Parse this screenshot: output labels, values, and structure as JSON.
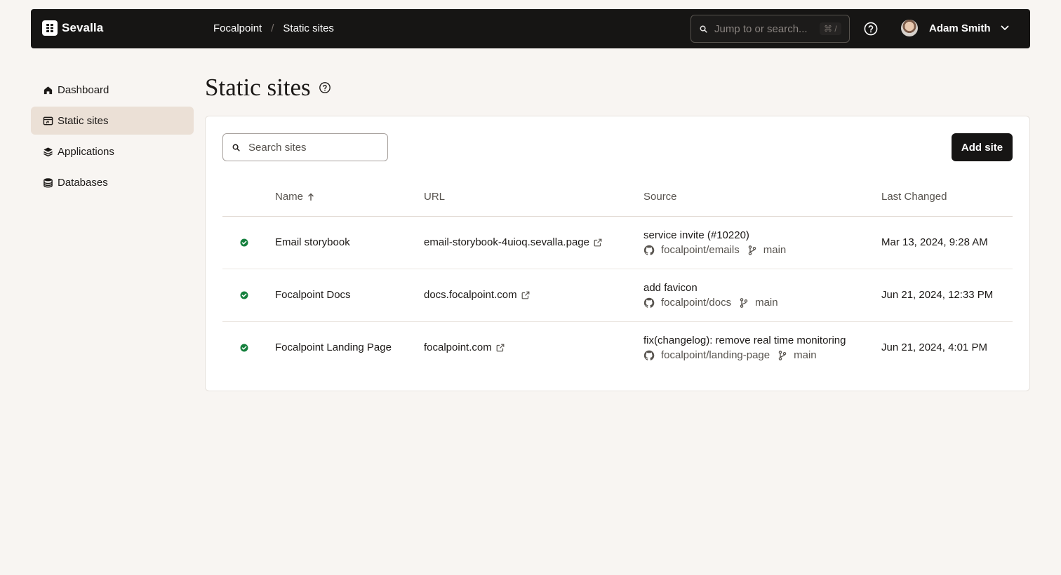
{
  "app": {
    "name": "Sevalla"
  },
  "breadcrumb": {
    "company": "Focalpoint",
    "separator": "/",
    "page": "Static sites"
  },
  "topbar": {
    "search_placeholder": "Jump to or search...",
    "shortcut": "⌘ /",
    "user_name": "Adam Smith"
  },
  "sidebar": {
    "items": [
      {
        "label": "Dashboard",
        "icon": "home-icon",
        "active": false
      },
      {
        "label": "Static sites",
        "icon": "static-site-icon",
        "active": true
      },
      {
        "label": "Applications",
        "icon": "layers-icon",
        "active": false
      },
      {
        "label": "Databases",
        "icon": "database-icon",
        "active": false
      }
    ]
  },
  "main": {
    "title": "Static sites",
    "search_placeholder": "Search sites",
    "add_button": "Add site",
    "columns": {
      "name": "Name",
      "url": "URL",
      "source": "Source",
      "last_changed": "Last Changed"
    },
    "sites": [
      {
        "status": "success",
        "name": "Email storybook",
        "url": "email-storybook-4uioq.sevalla.page",
        "commit": "service invite (#10220)",
        "repo": "focalpoint/emails",
        "branch": "main",
        "last_changed": "Mar 13, 2024, 9:28 AM"
      },
      {
        "status": "success",
        "name": "Focalpoint Docs",
        "url": "docs.focalpoint.com",
        "commit": "add favicon",
        "repo": "focalpoint/docs",
        "branch": "main",
        "last_changed": "Jun 21, 2024, 12:33 PM"
      },
      {
        "status": "success",
        "name": "Focalpoint Landing Page",
        "url": "focalpoint.com",
        "commit": "fix(changelog): remove real time monitoring",
        "repo": "focalpoint/landing-page",
        "branch": "main",
        "last_changed": "Jun 21, 2024, 4:01 PM"
      }
    ]
  },
  "colors": {
    "topbar": "#161514",
    "active_nav": "#ebe0d6",
    "success": "#15803d",
    "page_bg": "#f8f5f2"
  }
}
